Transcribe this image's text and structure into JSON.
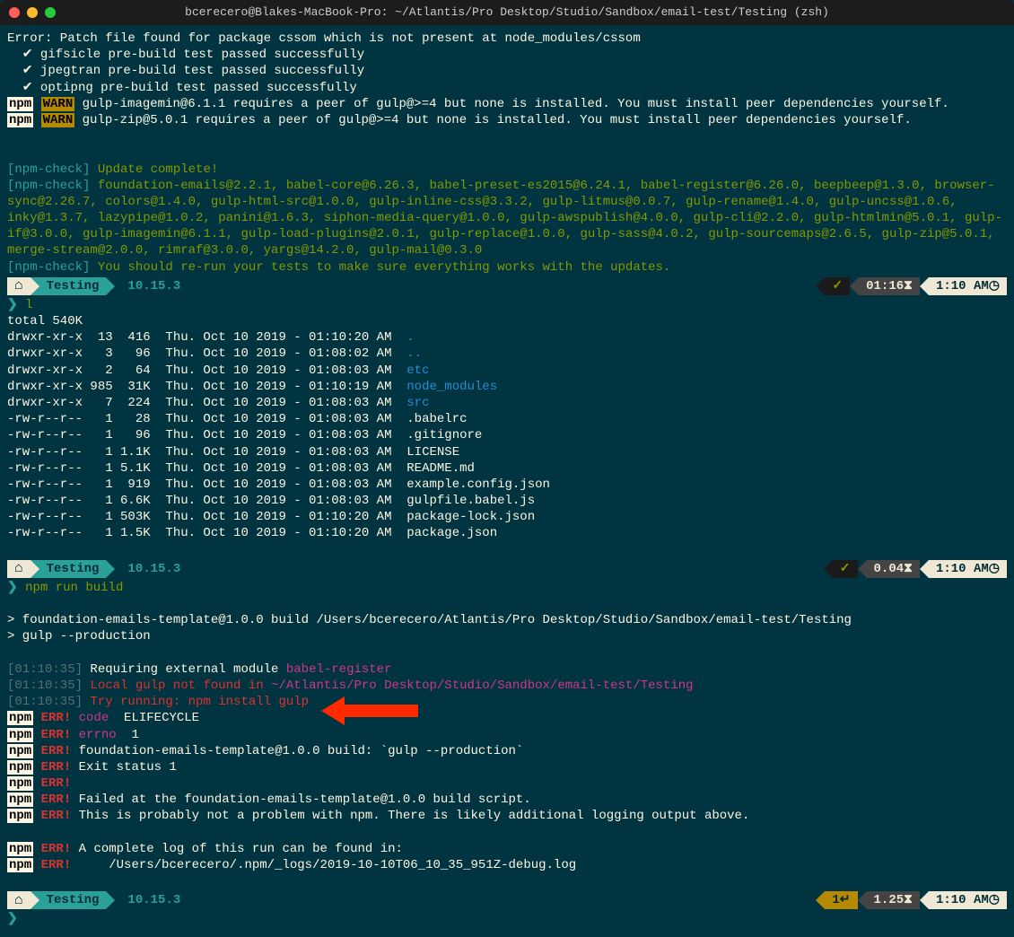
{
  "window": {
    "title": "bcerecero@Blakes-MacBook-Pro: ~/Atlantis/Pro Desktop/Studio/Sandbox/email-test/Testing (zsh)"
  },
  "error_line": "Error: Patch file found for package cssom which is not present at node_modules/cssom",
  "prebuild": [
    "  ✔ gifsicle pre-build test passed successfully",
    "  ✔ jpegtran pre-build test passed successfully",
    "  ✔ optipng pre-build test passed successfully"
  ],
  "npm_warns": [
    "gulp-imagemin@6.1.1 requires a peer of gulp@>=4 but none is installed. You must install peer dependencies yourself.",
    "gulp-zip@5.0.1 requires a peer of gulp@>=4 but none is installed. You must install peer dependencies yourself."
  ],
  "npm_check": {
    "prefix": "[npm-check]",
    "complete": " Update complete!",
    "pkgs": " foundation-emails@2.2.1, babel-core@6.26.3, babel-preset-es2015@6.24.1, babel-register@6.26.0, beepbeep@1.3.0, browser-sync@2.26.7, colors@1.4.0, gulp-html-src@1.0.0, gulp-inline-css@3.3.2, gulp-litmus@0.0.7, gulp-rename@1.4.0, gulp-uncss@1.0.6, inky@1.3.7, lazypipe@1.0.2, panini@1.6.3, siphon-media-query@1.0.0, gulp-awspublish@4.0.0, gulp-cli@2.2.0, gulp-htmlmin@5.0.1, gulp-if@3.0.0, gulp-imagemin@6.1.1, gulp-load-plugins@2.0.1, gulp-replace@1.0.0, gulp-sass@4.0.2, gulp-sourcemaps@2.6.5, gulp-zip@5.0.1, merge-stream@2.0.0, rimraf@3.0.0, yargs@14.2.0, gulp-mail@0.3.0",
    "tests": " You should re-run your tests to make sure everything works with the updates."
  },
  "prompts": [
    {
      "dir": "Testing",
      "version": "10.15.3",
      "ok": true,
      "dur": "01:16",
      "clock": "1:10 AM",
      "cmd": "l"
    },
    {
      "dir": "Testing",
      "version": "10.15.3",
      "ok": true,
      "dur": "0.04",
      "clock": "1:10 AM",
      "cmd": "npm run build"
    },
    {
      "dir": "Testing",
      "version": "10.15.3",
      "ok": false,
      "fail": "1",
      "dur": "1.25",
      "clock": "1:10 AM",
      "cmd": ""
    }
  ],
  "ls": {
    "total": "total 540K",
    "rows": [
      {
        "perm": "drwxr-xr-x",
        "n": "13",
        "sz": "416",
        "date": "Thu. Oct 10 2019 - 01:10:20 AM",
        "name": ".",
        "dir": true
      },
      {
        "perm": "drwxr-xr-x",
        "n": "3",
        "sz": "96",
        "date": "Thu. Oct 10 2019 - 01:08:02 AM",
        "name": "..",
        "dir": true
      },
      {
        "perm": "drwxr-xr-x",
        "n": "2",
        "sz": "64",
        "date": "Thu. Oct 10 2019 - 01:08:03 AM",
        "name": "etc",
        "dir": true
      },
      {
        "perm": "drwxr-xr-x",
        "n": "985",
        "sz": "31K",
        "date": "Thu. Oct 10 2019 - 01:10:19 AM",
        "name": "node_modules",
        "dir": true
      },
      {
        "perm": "drwxr-xr-x",
        "n": "7",
        "sz": "224",
        "date": "Thu. Oct 10 2019 - 01:08:03 AM",
        "name": "src",
        "dir": true
      },
      {
        "perm": "-rw-r--r--",
        "n": "1",
        "sz": "28",
        "date": "Thu. Oct 10 2019 - 01:08:03 AM",
        "name": ".babelrc",
        "dir": false
      },
      {
        "perm": "-rw-r--r--",
        "n": "1",
        "sz": "96",
        "date": "Thu. Oct 10 2019 - 01:08:03 AM",
        "name": ".gitignore",
        "dir": false
      },
      {
        "perm": "-rw-r--r--",
        "n": "1",
        "sz": "1.1K",
        "date": "Thu. Oct 10 2019 - 01:08:03 AM",
        "name": "LICENSE",
        "dir": false
      },
      {
        "perm": "-rw-r--r--",
        "n": "1",
        "sz": "5.1K",
        "date": "Thu. Oct 10 2019 - 01:08:03 AM",
        "name": "README.md",
        "dir": false
      },
      {
        "perm": "-rw-r--r--",
        "n": "1",
        "sz": "919",
        "date": "Thu. Oct 10 2019 - 01:08:03 AM",
        "name": "example.config.json",
        "dir": false
      },
      {
        "perm": "-rw-r--r--",
        "n": "1",
        "sz": "6.6K",
        "date": "Thu. Oct 10 2019 - 01:08:03 AM",
        "name": "gulpfile.babel.js",
        "dir": false
      },
      {
        "perm": "-rw-r--r--",
        "n": "1",
        "sz": "503K",
        "date": "Thu. Oct 10 2019 - 01:10:20 AM",
        "name": "package-lock.json",
        "dir": false
      },
      {
        "perm": "-rw-r--r--",
        "n": "1",
        "sz": "1.5K",
        "date": "Thu. Oct 10 2019 - 01:10:20 AM",
        "name": "package.json",
        "dir": false
      }
    ]
  },
  "build": {
    "script_line1": "> foundation-emails-template@1.0.0 build /Users/bcerecero/Atlantis/Pro Desktop/Studio/Sandbox/email-test/Testing",
    "script_line2": "> gulp --production",
    "t1": "[01:10:35]",
    "msg1a": " Requiring external module ",
    "msg1b": "babel-register",
    "t2": "[01:10:35]",
    "msg2a": " Local gulp not found in ",
    "msg2b": "~/Atlantis/Pro Desktop/Studio/Sandbox/email-test/Testing",
    "t3": "[01:10:35]",
    "msg3": " Try running: npm install gulp"
  },
  "errs": [
    {
      "k": "code",
      "v": " ELIFECYCLE"
    },
    {
      "k": "errno",
      "v": " 1"
    },
    {
      "k": "",
      "v": "foundation-emails-template@1.0.0 build: `gulp --production`"
    },
    {
      "k": "",
      "v": "Exit status 1"
    },
    {
      "k": "",
      "v": ""
    },
    {
      "k": "",
      "v": "Failed at the foundation-emails-template@1.0.0 build script."
    },
    {
      "k": "",
      "v": "This is probably not a problem with npm. There is likely additional logging output above."
    }
  ],
  "err_log": {
    "l1": "A complete log of this run can be found in:",
    "l2": "    /Users/bcerecero/.npm/_logs/2019-10-10T06_10_35_951Z-debug.log"
  },
  "labels": {
    "npm": "npm",
    "warn": "WARN",
    "err": "ERR!"
  }
}
